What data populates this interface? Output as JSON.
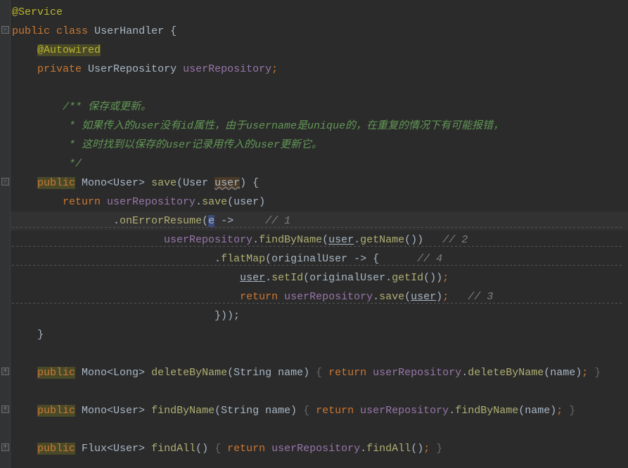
{
  "code": {
    "l1_anno": "@Service",
    "l2_public": "public",
    "l2_class": "class",
    "l2_name": "UserHandler",
    "l2_brace": " {",
    "l3_anno": "@Autowired",
    "l4_private": "private",
    "l4_type": "UserRepository",
    "l4_field": "userRepository",
    "l4_semi": ";",
    "l6_doc1": "/** 保存或更新。",
    "l7_doc2": " * 如果传入的user没有id属性，由于username是unique的，在重复的情况下有可能报错，",
    "l8_doc3": " * 这时找到以保存的user记录用传入的user更新它。",
    "l9_doc4": " */",
    "l10_public": "public",
    "l10_type": "Mono<User>",
    "l10_method": "save",
    "l10_p1": "(User",
    "l10_p2": "user",
    "l10_p3": ")",
    "l10_brace": " {",
    "l11_return": "return",
    "l11_field": " userRepository",
    "l11_dot": ".",
    "l11_save": "save",
    "l11_u": "(user)",
    "l12_dot": ".",
    "l12_m": "onErrorResume",
    "l12_p": "(",
    "l12_lambda_e": "e",
    "l12_arrow": " ->",
    "l12_c": "   // 1",
    "l13_field": "userRepository",
    "l13_dot": ".",
    "l13_m": "findByName",
    "l13_p": "(",
    "l13_u": "user",
    "l13_dot2": ".",
    "l13_m2": "getName",
    "l13_p2": "())",
    "l13_c": "   // 2",
    "l14_dot": ".",
    "l14_m": "flatMap",
    "l14_p": "(originalUser -> {",
    "l14_c": "      // 4",
    "l15_u": "user",
    "l15_dot": ".",
    "l15_m": "setId",
    "l15_p": "(originalUser.",
    "l15_m2": "getId",
    "l15_p2": "())",
    "l15_semi": ";",
    "l16_return": "return",
    "l16_field": " userRepository",
    "l16_dot": ".",
    "l16_m": "save",
    "l16_p": "(",
    "l16_u": "user",
    "l16_p2": ")",
    "l16_semi": ";",
    "l16_c": "   // 3",
    "l17_close": "}));",
    "l18_brace": "}",
    "l20_public": "public",
    "l20_type": " Mono<Long>",
    "l20_method": " deleteByName",
    "l20_param": "(String name)",
    "l20_b1": " {",
    "l20_return": " return",
    "l20_field": " userRepository",
    "l20_dot": ".",
    "l20_m": "deleteByName",
    "l20_p": "(name)",
    "l20_semi": ";",
    "l20_b2": " }",
    "l22_public": "public",
    "l22_type": " Mono<User>",
    "l22_method": " findByName",
    "l22_param": "(String name)",
    "l22_b1": " {",
    "l22_return": " return",
    "l22_field": " userRepository",
    "l22_dot": ".",
    "l22_m": "findByName",
    "l22_p": "(name)",
    "l22_semi": ";",
    "l22_b2": " }",
    "l24_public": "public",
    "l24_type": " Flux<User>",
    "l24_method": " findAll",
    "l24_param": "()",
    "l24_b1": " {",
    "l24_return": " return",
    "l24_field": " userRepository",
    "l24_dot": ".",
    "l24_m": "findAll",
    "l24_p": "()",
    "l24_semi": ";",
    "l24_b2": " }"
  }
}
